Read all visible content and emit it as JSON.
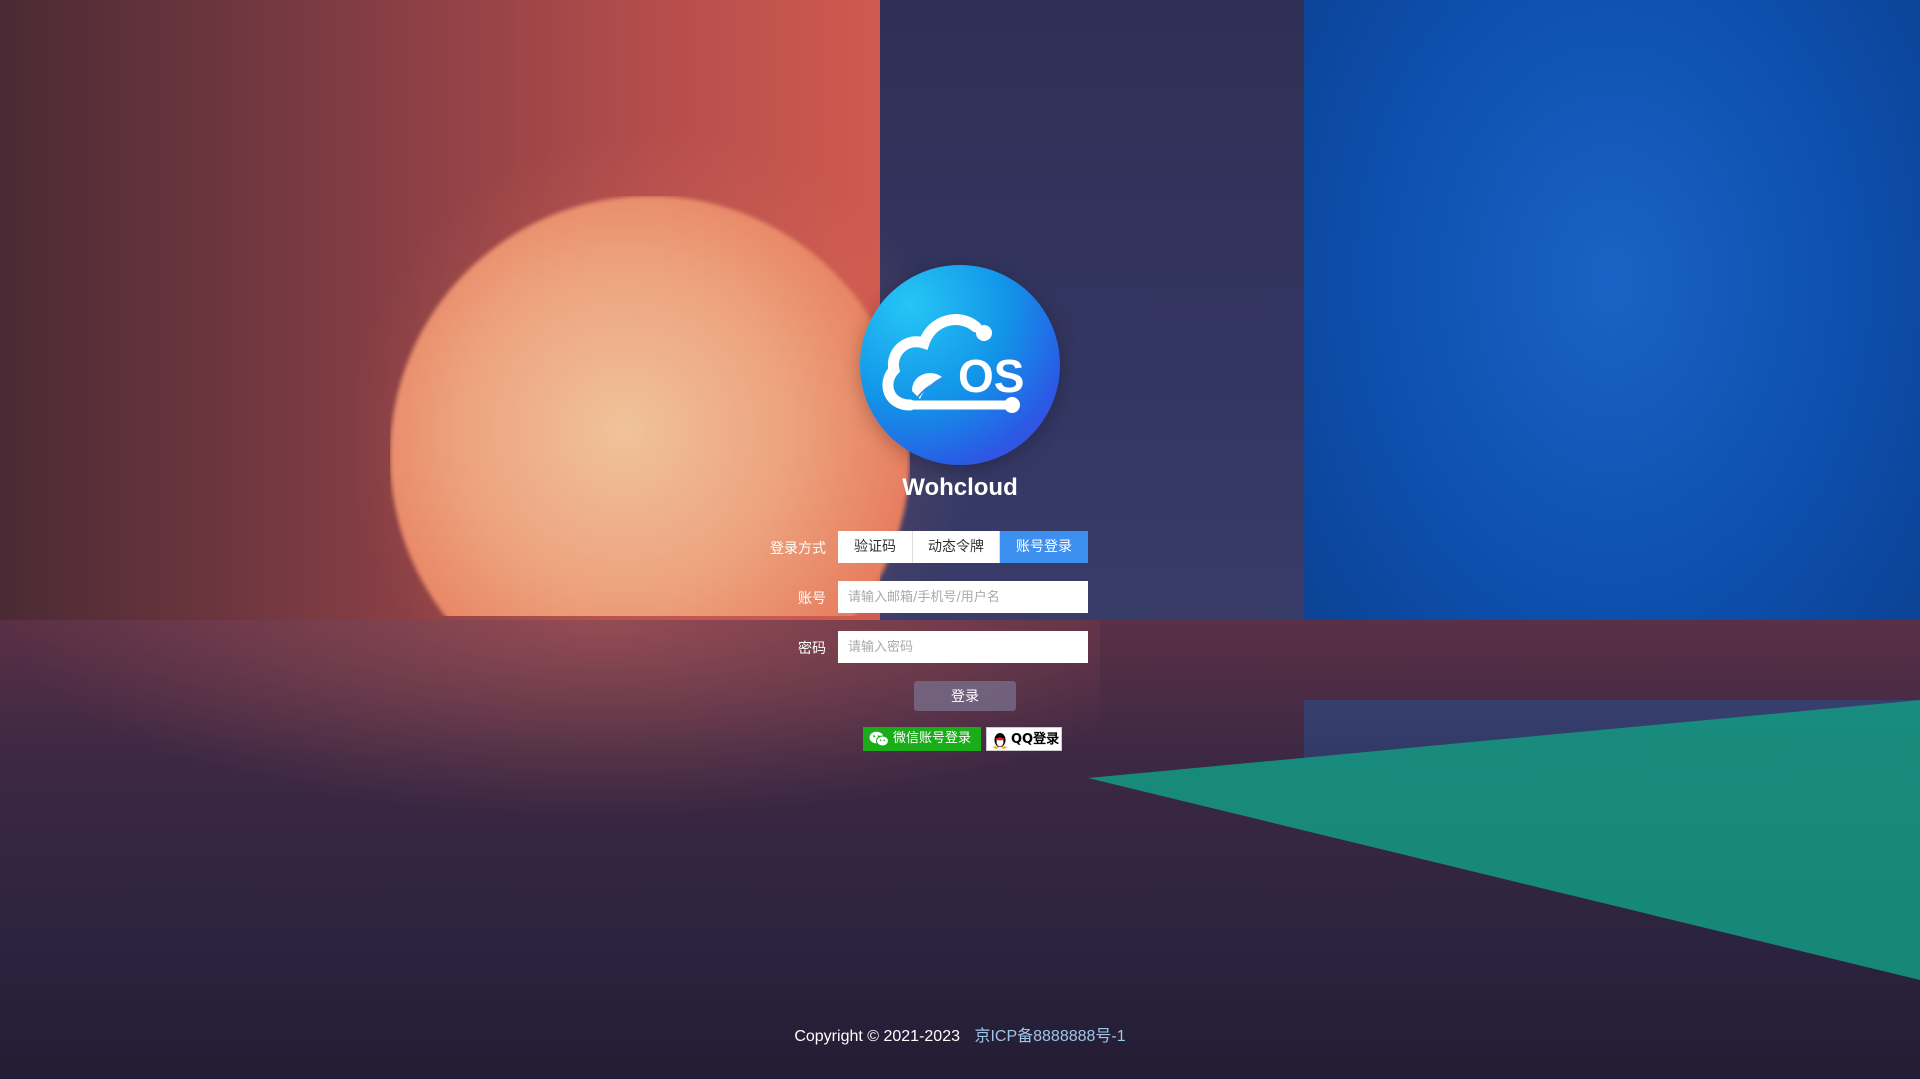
{
  "app": {
    "name": "Wohcloud",
    "logo_text": "OS"
  },
  "login": {
    "method_label": "登录方式",
    "methods": [
      {
        "label": "验证码",
        "active": false
      },
      {
        "label": "动态令牌",
        "active": false
      },
      {
        "label": "账号登录",
        "active": true
      }
    ],
    "account_label": "账号",
    "account_placeholder": "请输入邮箱/手机号/用户名",
    "password_label": "密码",
    "password_placeholder": "请输入密码",
    "submit_label": "登录",
    "wechat_label": "微信账号登录",
    "qq_label": "QQ登录"
  },
  "footer": {
    "copyright": "Copyright © 2021-2023",
    "icp": "京ICP备8888888号-1"
  },
  "colors": {
    "accent": "#3d8ff0",
    "wechat": "#1aad19"
  }
}
